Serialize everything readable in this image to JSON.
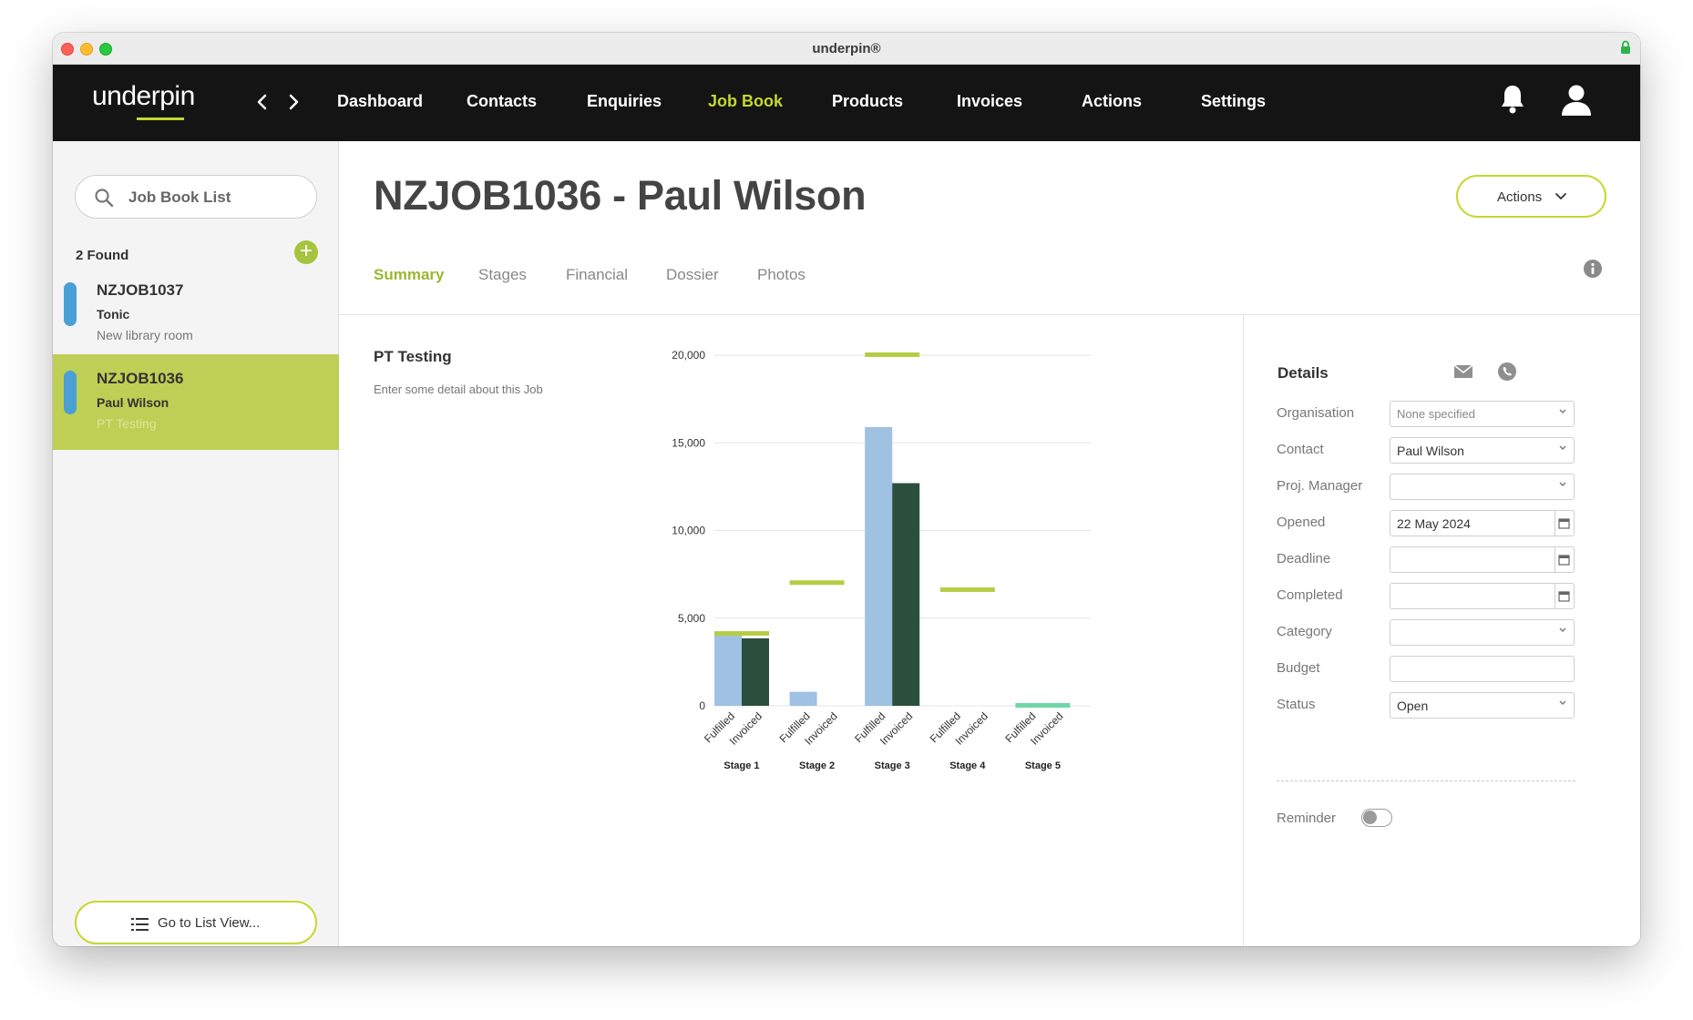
{
  "window": {
    "title": "underpin®"
  },
  "brand": {
    "logo_text": "underpin",
    "accent_color": "#c4d82e"
  },
  "nav": {
    "items": [
      {
        "label": "Dashboard",
        "active": false
      },
      {
        "label": "Contacts",
        "active": false
      },
      {
        "label": "Enquiries",
        "active": false
      },
      {
        "label": "Job Book",
        "active": true
      },
      {
        "label": "Products",
        "active": false
      },
      {
        "label": "Invoices",
        "active": false
      },
      {
        "label": "Actions",
        "active": false
      },
      {
        "label": "Settings",
        "active": false
      }
    ],
    "icons": [
      "chevron-left-icon",
      "chevron-right-icon",
      "bell-icon",
      "user-icon"
    ]
  },
  "sidebar": {
    "search_placeholder": "Job Book List",
    "found_text": "2 Found",
    "add_symbol": "+",
    "jobs": [
      {
        "code": "NZJOB1037",
        "name": "Tonic",
        "description": "New library room",
        "selected": false,
        "tag_color": "#4a9fd5"
      },
      {
        "code": "NZJOB1036",
        "name": "Paul Wilson",
        "description": "PT Testing",
        "selected": true,
        "tag_color": "#4a9fd5"
      }
    ],
    "list_view_label": "Go to List View..."
  },
  "main": {
    "title": "NZJOB1036 - Paul Wilson",
    "actions_label": "Actions",
    "tabs": [
      {
        "label": "Summary",
        "active": true
      },
      {
        "label": "Stages",
        "active": false
      },
      {
        "label": "Financial",
        "active": false
      },
      {
        "label": "Dossier",
        "active": false
      },
      {
        "label": "Photos",
        "active": false
      }
    ],
    "section_title": "PT Testing",
    "section_desc": "Enter some detail about this Job"
  },
  "chart_data": {
    "type": "bar",
    "categories": [
      "Stage 1",
      "Stage 2",
      "Stage 3",
      "Stage 4",
      "Stage 5"
    ],
    "sub_labels": [
      "Fulfilled",
      "Invoiced"
    ],
    "series": [
      {
        "name": "Fulfilled",
        "color": "#9fc1e2",
        "values": [
          4000,
          800,
          15900,
          0,
          0
        ]
      },
      {
        "name": "Invoiced",
        "color": "#2a4f3c",
        "values": [
          3850,
          0,
          12700,
          0,
          0
        ]
      }
    ],
    "target": {
      "color": "#b5cd45",
      "values": [
        4100,
        7000,
        20000,
        6600,
        0
      ]
    },
    "target_zero_color": "#6fd6a6",
    "yticks": [
      0,
      5000,
      10000,
      15000,
      20000
    ],
    "ytick_labels": [
      "0",
      "5,000",
      "10,000",
      "15,000",
      "20,000"
    ],
    "ylim": [
      0,
      20000
    ],
    "grid": true
  },
  "details": {
    "title": "Details",
    "fields": [
      {
        "label": "Organisation",
        "value": "None specified",
        "placeholder": true,
        "kind": "select"
      },
      {
        "label": "Contact",
        "value": "Paul Wilson",
        "placeholder": false,
        "kind": "select"
      },
      {
        "label": "Proj. Manager",
        "value": "",
        "placeholder": false,
        "kind": "select"
      },
      {
        "label": "Opened",
        "value": "22 May 2024",
        "placeholder": false,
        "kind": "date"
      },
      {
        "label": "Deadline",
        "value": "",
        "placeholder": false,
        "kind": "date"
      },
      {
        "label": "Completed",
        "value": "",
        "placeholder": false,
        "kind": "date"
      },
      {
        "label": "Category",
        "value": "",
        "placeholder": false,
        "kind": "select"
      },
      {
        "label": "Budget",
        "value": "",
        "placeholder": false,
        "kind": "text"
      },
      {
        "label": "Status",
        "value": "Open",
        "placeholder": false,
        "kind": "select"
      }
    ],
    "reminder_label": "Reminder",
    "reminder_on": false
  }
}
